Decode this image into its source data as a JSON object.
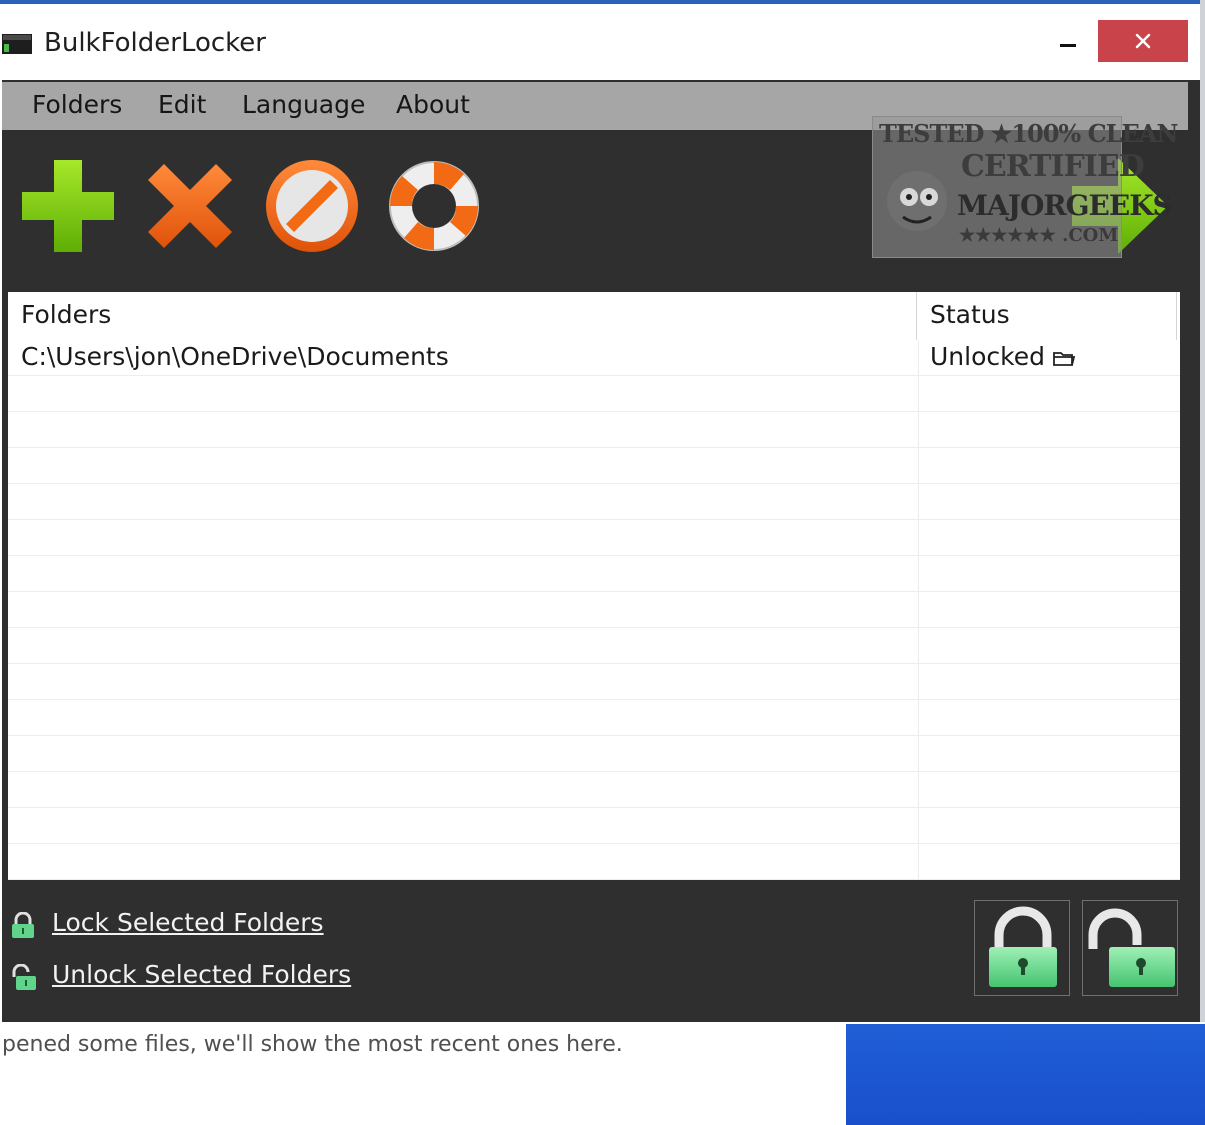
{
  "window": {
    "title": "BulkFolderLocker",
    "minimize_icon": "minimize-icon",
    "close_icon": "close-icon"
  },
  "menu": {
    "items": [
      "Folders",
      "Edit",
      "Language",
      "About"
    ]
  },
  "toolbar": {
    "buttons": [
      {
        "icon": "add-plus-icon",
        "color": "#7ac70c"
      },
      {
        "icon": "remove-x-icon",
        "color": "#f26a13"
      },
      {
        "icon": "cancel-icon",
        "color": "#f26a13"
      },
      {
        "icon": "help-lifebuoy-icon",
        "color": "#f26a13"
      },
      {
        "icon": "next-arrow-icon",
        "color": "#7ac70c"
      }
    ]
  },
  "watermark": {
    "line1": "TESTED ★100% CLEAN",
    "line2": "CERTIFIED",
    "line3": "MAJORGEEKS",
    "line4": "★★★★★★ .COM"
  },
  "table": {
    "columns": [
      "Folders",
      "Status"
    ],
    "rows": [
      {
        "folder": "C:\\Users\\jon\\OneDrive\\Documents",
        "status": "Unlocked",
        "status_icon": "open-folder-icon"
      }
    ]
  },
  "actions": {
    "lock_label": "Lock Selected Folders",
    "unlock_label": "Unlock Selected Folders"
  },
  "background": {
    "recent_text": "pened some files, we'll show the most recent ones here."
  },
  "colors": {
    "titlebar_accent": "#2b63b8",
    "close_button": "#c8434a",
    "menu_bar": "#a6a6a6",
    "app_background": "#2f2f2f",
    "lock_green": "#5fd48a",
    "desktop_blue": "#1f5fd6"
  }
}
